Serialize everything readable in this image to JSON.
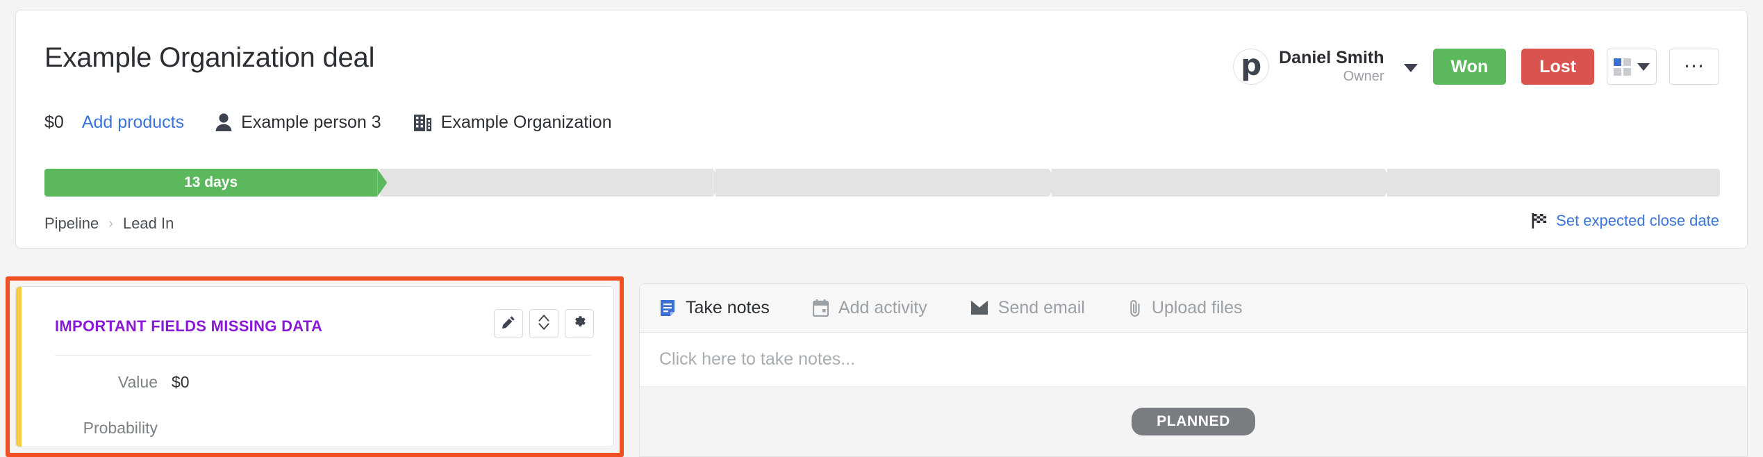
{
  "deal": {
    "title": "Example Organization deal",
    "amount": "$0",
    "add_products_label": "Add products",
    "person": "Example person 3",
    "organization": "Example Organization"
  },
  "owner": {
    "avatar_letter": "p",
    "name": "Daniel Smith",
    "role": "Owner"
  },
  "actions": {
    "won_label": "Won",
    "lost_label": "Lost"
  },
  "pipeline": {
    "stages": [
      {
        "label": "13 days",
        "state": "done"
      },
      {
        "label": "",
        "state": "pending"
      },
      {
        "label": "",
        "state": "pending"
      },
      {
        "label": "",
        "state": "pending"
      },
      {
        "label": "",
        "state": "pending"
      }
    ],
    "breadcrumb": {
      "pipeline_label": "Pipeline",
      "separator": "›",
      "stage_label": "Lead In"
    },
    "close_date_label": "Set expected close date"
  },
  "fields_card": {
    "heading": "IMPORTANT FIELDS MISSING DATA",
    "rows": [
      {
        "label": "Value",
        "value": "$0"
      },
      {
        "label": "Probability",
        "value": ""
      }
    ]
  },
  "activity": {
    "tabs": [
      {
        "label": "Take notes",
        "icon": "note-icon",
        "active": true
      },
      {
        "label": "Add activity",
        "icon": "calendar-icon",
        "active": false
      },
      {
        "label": "Send email",
        "icon": "envelope-icon",
        "active": false
      },
      {
        "label": "Upload files",
        "icon": "paperclip-icon",
        "active": false
      }
    ],
    "note_placeholder": "Click here to take notes...",
    "planned_label": "PLANNED"
  },
  "colors": {
    "won_green": "#5cb85c",
    "lost_red": "#d9534f",
    "link_blue": "#3b74db",
    "heading_purple": "#8a19d6",
    "accent_yellow": "#f7cd46",
    "annotation_red": "#f04e23",
    "planned_gray": "#797d81"
  }
}
